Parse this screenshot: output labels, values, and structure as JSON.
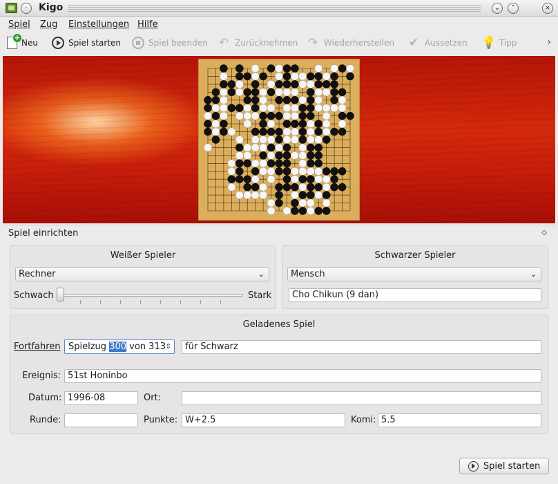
{
  "window": {
    "title": "Kigo"
  },
  "menu": [
    "Spiel",
    "Zug",
    "Einstellungen",
    "Hilfe"
  ],
  "toolbar": {
    "new": "Neu",
    "start": "Spiel starten",
    "end": "Spiel beenden",
    "undo": "Zurücknehmen",
    "redo": "Wiederherstellen",
    "pass": "Aussetzen",
    "hint": "Tipp"
  },
  "setup": {
    "title": "Spiel einrichten",
    "white": {
      "title": "Weißer Spieler",
      "type": "Rechner",
      "weak": "Schwach",
      "strong": "Stark",
      "strength": 0
    },
    "black": {
      "title": "Schwarzer Spieler",
      "type": "Mensch",
      "name": "Cho Chikun (9 dan)"
    },
    "loaded": {
      "title": "Geladenes Spiel",
      "continue_label": "Fortfahren",
      "move_prefix": "Spielzug ",
      "move": "300",
      "move_suffix": " von 313",
      "for_player": "für Schwarz",
      "event_label": "Ereignis:",
      "event": "51st Honinbo",
      "date_label": "Datum:",
      "date": "1996-08",
      "place_label": "Ort:",
      "place": "",
      "round_label": "Runde:",
      "round": "",
      "score_label": "Punkte:",
      "score": "W+2.5",
      "komi_label": "Komi:",
      "komi": "5.5"
    },
    "start_button": "Spiel starten"
  },
  "board": {
    "size": 19,
    "stones": [
      "..B.B.W.BWBB..W.WBW",
      "..W.BBWB.WBWWBBWB.B",
      "..BBW.B.WBBBWWBBB..",
      ".BWBWBBWBWWW.BWWBB.",
      "BBW..BBW.BBBWBW.BW.",
      "BWWBBWBWW.WWBBWWWW.",
      "WBW.WWWBBBWWBB.W.BB",
      "BWB..W.BW.BBBWBW.W.",
      "BWBW..BBBBWWBWBWBB.",
      ".B..W.WWWBWWBWWB...",
      "W...BWWWBWB.WBB....",
      "....WW.BWBBWWBB....",
      "...WBBWWBBB.WBB....",
      "...WB.BWWBBWWWWBBB.",
      "...BBBW.W.BWBBWWB..",
      "...W.BBW.BBBWBBWBB.",
      "....WWWW.B.WBBWB...",
      "........WB.BWW.W...",
      "........W.WBBWBB..."
    ]
  }
}
